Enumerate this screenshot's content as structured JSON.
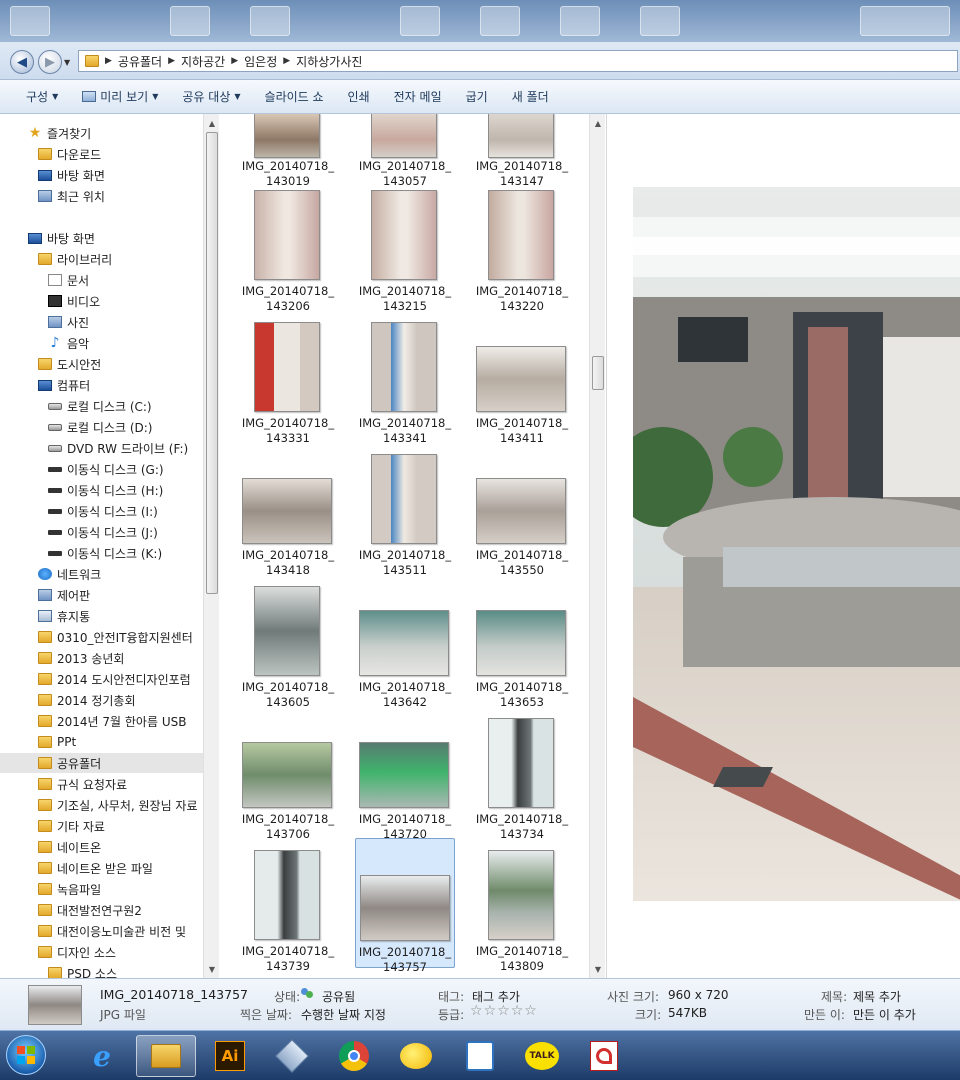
{
  "address": {
    "breadcrumb": [
      "공유폴더",
      "지하공간",
      "임은정",
      "지하상가사진"
    ]
  },
  "toolbar": [
    {
      "label": "구성",
      "dropdown": true
    },
    {
      "label": "미리 보기",
      "dropdown": true
    },
    {
      "label": "공유 대상",
      "dropdown": true
    },
    {
      "label": "슬라이드 쇼",
      "dropdown": false
    },
    {
      "label": "인쇄",
      "dropdown": false
    },
    {
      "label": "전자 메일",
      "dropdown": false
    },
    {
      "label": "굽기",
      "dropdown": false
    },
    {
      "label": "새 폴더",
      "dropdown": false
    }
  ],
  "nav": {
    "favorites": [
      "즐겨찾기",
      "다운로드",
      "바탕 화면",
      "최근 위치"
    ],
    "desktop": "바탕 화면",
    "library": "라이브러리",
    "library_items": [
      "문서",
      "비디오",
      "사진",
      "음악"
    ],
    "user": "도시안전",
    "computer": "컴퓨터",
    "drives": [
      "로컬 디스크 (C:)",
      "로컬 디스크 (D:)",
      "DVD RW 드라이브 (F:)",
      "이동식 디스크 (G:)",
      "이동식 디스크 (H:)",
      "이동식 디스크 (I:)",
      "이동식 디스크 (J:)",
      "이동식 디스크 (K:)"
    ],
    "others": [
      "네트워크",
      "제어판",
      "휴지통"
    ],
    "folders": [
      "0310_안전IT융합지원센터",
      "2013 송년회",
      "2014 도시안전디자인포럼",
      "2014 정기총회",
      "2014년 7월 한아름 USB",
      "PPt",
      "공유폴더",
      "규식 요청자료",
      "기조실, 사무처, 원장님 자료",
      "기타 자료",
      "네이트온",
      "네이트온 받은 파일",
      "녹음파일",
      "대전발전연구원2",
      "대전이응노미술관 비전 및",
      "디자인 소스",
      "PSD 소스"
    ]
  },
  "files": [
    {
      "name1": "IMG_20140718_",
      "name2": "143019"
    },
    {
      "name1": "IMG_20140718_",
      "name2": "143057"
    },
    {
      "name1": "IMG_20140718_",
      "name2": "143147"
    },
    {
      "name1": "IMG_20140718_",
      "name2": "143206"
    },
    {
      "name1": "IMG_20140718_",
      "name2": "143215"
    },
    {
      "name1": "IMG_20140718_",
      "name2": "143220"
    },
    {
      "name1": "IMG_20140718_",
      "name2": "143331"
    },
    {
      "name1": "IMG_20140718_",
      "name2": "143341"
    },
    {
      "name1": "IMG_20140718_",
      "name2": "143411"
    },
    {
      "name1": "IMG_20140718_",
      "name2": "143418"
    },
    {
      "name1": "IMG_20140718_",
      "name2": "143511"
    },
    {
      "name1": "IMG_20140718_",
      "name2": "143550"
    },
    {
      "name1": "IMG_20140718_",
      "name2": "143605"
    },
    {
      "name1": "IMG_20140718_",
      "name2": "143642"
    },
    {
      "name1": "IMG_20140718_",
      "name2": "143653"
    },
    {
      "name1": "IMG_20140718_",
      "name2": "143706"
    },
    {
      "name1": "IMG_20140718_",
      "name2": "143720"
    },
    {
      "name1": "IMG_20140718_",
      "name2": "143734"
    },
    {
      "name1": "IMG_20140718_",
      "name2": "143739"
    },
    {
      "name1": "IMG_20140718_",
      "name2": "143757"
    },
    {
      "name1": "IMG_20140718_",
      "name2": "143809"
    }
  ],
  "details": {
    "filename": "IMG_20140718_143757",
    "filetype": "JPG 파일",
    "state_label": "상태:",
    "state_value": "공유됨",
    "date_label": "찍은 날짜:",
    "date_value": "수행한 날짜 지정",
    "tag_label": "태그:",
    "tag_value": "태그 추가",
    "rating_label": "등급:",
    "rating": 0,
    "size_label": "사진 크기:",
    "size_value": "960 x 720",
    "bytes_label": "크기:",
    "bytes_value": "547KB",
    "title_label": "제목:",
    "title_value": "제목 추가",
    "author_label": "만든 이:",
    "author_value": "만든 이 추가"
  },
  "taskbar": {
    "illustrator": "Ai",
    "kakao": "TALK"
  },
  "colors": {
    "selection": "#d6e8fb",
    "toolbar_text": "#1e395b",
    "taskbar": "#1d3b68"
  }
}
